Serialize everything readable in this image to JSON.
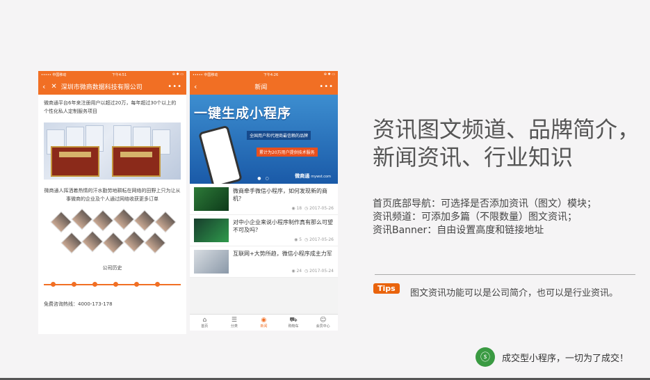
{
  "phone1": {
    "status": {
      "carrier": "••••• 中国移动 ",
      "time": "下午4:51",
      "battery": "⊕ ✱ ▭"
    },
    "title": "深圳市微商数据科技有限公司",
    "intro": "微商通平台6年来注册用户以超过20万，每年超过30个以上的个性化私人定制服务项目",
    "desc": "微商通人挥洒着热情的汗水勤劳地耕耘在网络的田野上只为让从事微商的企业及个人通过网络收获更多订单",
    "history_title": "公司历史",
    "hotline": "免费咨询热线：4000-173-178"
  },
  "phone2": {
    "status": {
      "carrier": "••••• 中国移动 ",
      "time": "下午4:26",
      "battery": "⊕ ✱ ▭"
    },
    "title": "新闻",
    "banner": {
      "headline": "一键生成小程序",
      "sub1": "全国用户和代理商最信赖的品牌",
      "sub2": "累计为20万用户提供技术服务",
      "brand": "微商通",
      "url": "mywst.com"
    },
    "news": [
      {
        "title": "微商牵手微信小程序，如何发现新的商机？",
        "views": "18",
        "date": "2017-05-26"
      },
      {
        "title": "对中小企业来说小程序制作真有那么可望不可及吗？",
        "views": "5",
        "date": "2017-05-26"
      },
      {
        "title": "互联网+大势所趋，微信小程序成主力军",
        "views": "24",
        "date": "2017-05-24"
      }
    ],
    "tabs": [
      {
        "icon": "⌂",
        "label": "首页"
      },
      {
        "icon": "☰",
        "label": "分类"
      },
      {
        "icon": "◉",
        "label": "新闻"
      },
      {
        "icon": "⛟",
        "label": "购物车"
      },
      {
        "icon": "☺",
        "label": "会员中心"
      }
    ]
  },
  "headline": {
    "line1": "资讯图文频道、品牌简介，",
    "line2": "新闻资讯、行业知识"
  },
  "features": [
    "首页底部导航：可选择是否添加资讯（图文）模块；",
    "资讯频道：可添加多篇（不限数量）图文资讯；",
    "资讯Banner：自由设置高度和链接地址"
  ],
  "tips": {
    "label": "Tips",
    "text": "图文资讯功能可以是公司简介，也可以是行业资讯。"
  },
  "slogan": "成交型小程序，一切为了成交！"
}
